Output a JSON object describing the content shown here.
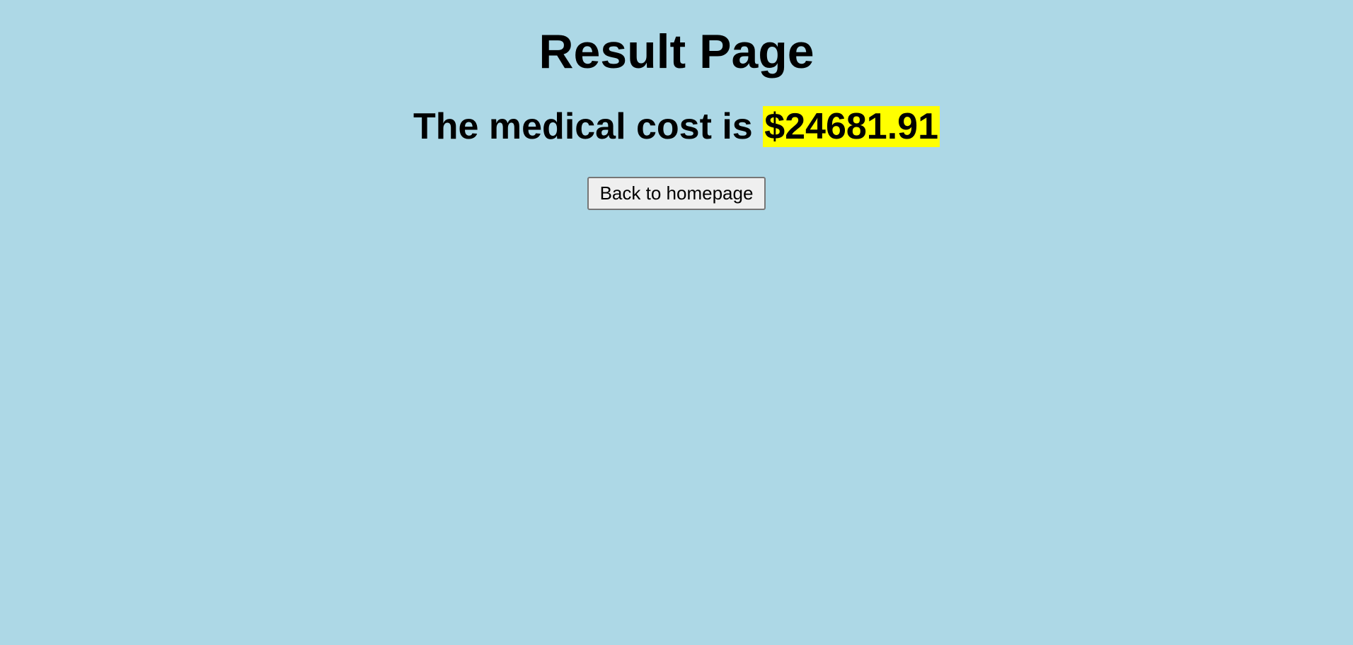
{
  "page": {
    "title": "Result Page",
    "result_prefix": "The medical cost is",
    "result_value": "$24681.91",
    "back_button_label": "Back to homepage"
  },
  "colors": {
    "background": "#add8e6",
    "highlight": "#ffff00"
  }
}
